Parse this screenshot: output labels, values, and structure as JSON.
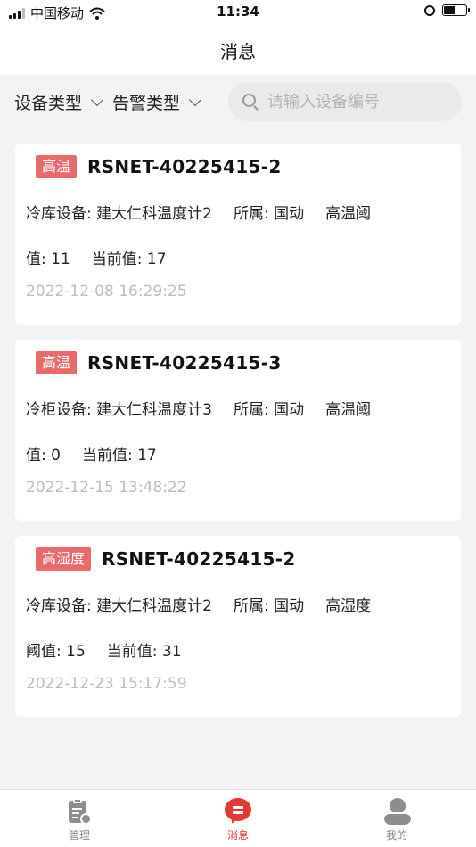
{
  "status_bar": {
    "carrier": "中国移动",
    "time": "11:34"
  },
  "header": {
    "title": "消息"
  },
  "filters": {
    "device_type": "设备类型",
    "alarm_type": "告警类型",
    "search_placeholder": "请输入设备编号"
  },
  "alerts": [
    {
      "tag": "高温",
      "device_code": "RSNET-40225415-2",
      "device_label": "冷库设备: 建大仁科温度计2",
      "owner_label": "所属: 国动",
      "threshold_label_part1": "高温阈",
      "threshold_label_part2": "值: 11",
      "current_value": "当前值: 17",
      "timestamp": "2022-12-08 16:29:25"
    },
    {
      "tag": "高温",
      "device_code": "RSNET-40225415-3",
      "device_label": "冷柜设备: 建大仁科温度计3",
      "owner_label": "所属: 国动",
      "threshold_label_part1": "高温阈",
      "threshold_label_part2": "值: 0",
      "current_value": "当前值: 17",
      "timestamp": "2022-12-15 13:48:22"
    },
    {
      "tag": "高湿度",
      "device_code": "RSNET-40225415-2",
      "device_label": "冷库设备: 建大仁科温度计2",
      "owner_label": "所属: 国动",
      "threshold_label_part1": "高湿度",
      "threshold_label_part2": "阈值: 15",
      "current_value": "当前值: 31",
      "timestamp": "2022-12-23 15:17:59"
    }
  ],
  "tab_bar": {
    "manage": "管理",
    "messages": "消息",
    "mine": "我的",
    "active": "messages",
    "accent_color": "#e53935"
  },
  "colors": {
    "tag_background": "#e86a6a",
    "page_background": "#f2f3f5"
  }
}
